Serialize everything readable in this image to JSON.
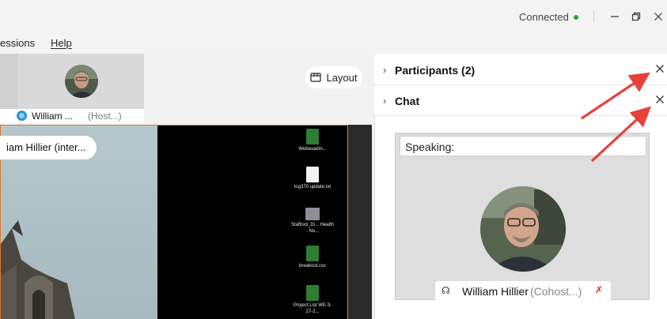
{
  "titlebar": {
    "status": "Connected",
    "status_color": "#2ca52c",
    "minimize_icon": "minimize-icon",
    "restore_icon": "restore-icon",
    "close_icon": "close-icon"
  },
  "menu": {
    "items": [
      "essions",
      "Help"
    ]
  },
  "thumbnail": {
    "name": "William ...",
    "role": "(Host...)"
  },
  "layout_button": {
    "label": "Layout"
  },
  "share": {
    "presenter_chip": "iam Hillier (inter...",
    "desktop_icons": [
      {
        "caption": "Webexadm...",
        "kind": "excel"
      },
      {
        "caption": "log370 update.txt",
        "kind": "text"
      },
      {
        "caption": "Stafford_Di... Health - Nu...",
        "kind": "image"
      },
      {
        "caption": "breakout.csv",
        "kind": "excel"
      },
      {
        "caption": "Project List WE-3-27-2...",
        "kind": "excel"
      }
    ]
  },
  "panels": {
    "participants": {
      "title": "Participants (2)"
    },
    "chat": {
      "title": "Chat"
    }
  },
  "speaking": {
    "label": "Speaking:",
    "name": "William Hillier",
    "role": "(Cohost...)"
  },
  "colors": {
    "accent_border": "#d8792f",
    "annotation_arrow": "#e8403a"
  }
}
